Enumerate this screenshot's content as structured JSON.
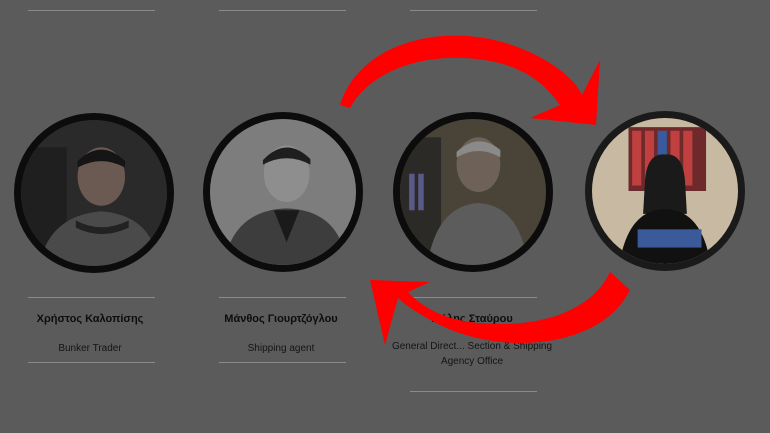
{
  "team": [
    {
      "name": "Χρήστος Καλοπίσης",
      "role": "Bunker Trader"
    },
    {
      "name": "Μάνθος Γιουρτζόγλου",
      "role": "Shipping agent"
    },
    {
      "name": "...ήλης Σταύρου",
      "role": "General Direct... Section & Shipping Agency Office"
    },
    {
      "name": "",
      "role": ""
    }
  ],
  "colors": {
    "background": "#5b5b5b",
    "arrow": "#ff0000",
    "ring": "#0c0c0c"
  },
  "icons": {
    "swap_arrows": "circular-swap-arrows-icon"
  }
}
